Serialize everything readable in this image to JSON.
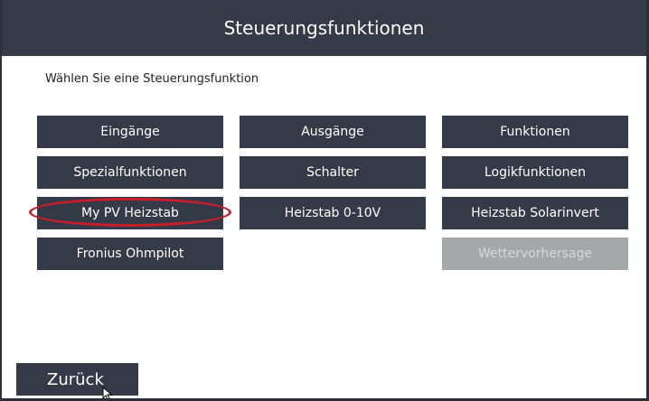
{
  "header": {
    "title": "Steuerungsfunktionen"
  },
  "main": {
    "prompt": "Wählen Sie eine Steuerungsfunktion",
    "functions": [
      {
        "label": "Eingänge",
        "enabled": true
      },
      {
        "label": "Ausgänge",
        "enabled": true
      },
      {
        "label": "Funktionen",
        "enabled": true
      },
      {
        "label": "Spezialfunktionen",
        "enabled": true
      },
      {
        "label": "Schalter",
        "enabled": true
      },
      {
        "label": "Logikfunktionen",
        "enabled": true
      },
      {
        "label": "My PV Heizstab",
        "enabled": true,
        "highlighted": true
      },
      {
        "label": "Heizstab 0-10V",
        "enabled": true
      },
      {
        "label": "Heizstab Solarinvert",
        "enabled": true
      },
      {
        "label": "Fronius Ohmpilot",
        "enabled": true
      },
      {
        "label": "Wettervorhersage",
        "enabled": false
      }
    ]
  },
  "footer": {
    "back_label": "Zurück"
  },
  "colors": {
    "button": "#343a48",
    "disabled_button": "#a4a8a8",
    "highlight": "#c81e2a"
  },
  "icons": {
    "pointer": "mouse-pointer-icon"
  }
}
